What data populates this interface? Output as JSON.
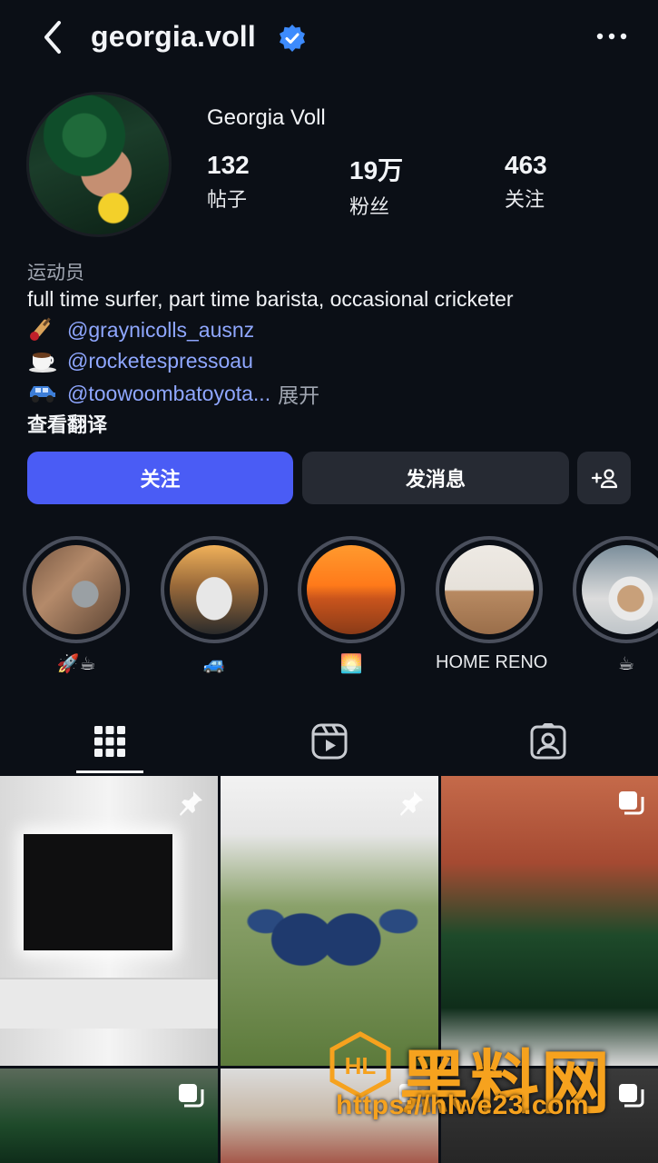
{
  "header": {
    "username": "georgia.voll",
    "verified": true,
    "icons": {
      "back": "back-chevron-icon",
      "verified": "verified-badge-icon",
      "more": "more-dots-icon"
    }
  },
  "profile": {
    "display_name": "Georgia Voll",
    "stats": [
      {
        "value": "132",
        "label": "帖子"
      },
      {
        "value": "19万",
        "label": "粉丝"
      },
      {
        "value": "463",
        "label": "关注"
      }
    ],
    "category": "运动员",
    "bio_text": "full time surfer, part time barista, occasional cricketer",
    "bio_links": [
      {
        "emoji": "cricket-bat-icon",
        "handle": "@graynicolls_ausnz"
      },
      {
        "emoji": "coffee-cup-icon",
        "handle": "@rocketespressoau"
      },
      {
        "emoji": "car-icon",
        "handle": "@toowoombatoyota",
        "truncated": "...",
        "expand": "展开"
      }
    ],
    "translate": "查看翻译"
  },
  "actions": {
    "follow": "关注",
    "message": "发消息",
    "add_user_icon": "add-person-icon"
  },
  "highlights": [
    {
      "label": "🚀☕",
      "icon": "rocket-coffee"
    },
    {
      "label": "🚙",
      "icon": "car"
    },
    {
      "label": "🌅",
      "icon": "sunset"
    },
    {
      "label": "HOME RENO",
      "icon": ""
    },
    {
      "label": "☕",
      "icon": "coffee"
    }
  ],
  "tabs": [
    {
      "name": "grid-tab",
      "icon": "grid-icon",
      "active": true
    },
    {
      "name": "reels-tab",
      "icon": "reels-icon",
      "active": false
    },
    {
      "name": "tagged-tab",
      "icon": "tagged-person-icon",
      "active": false
    }
  ],
  "grid_badges": [
    "pin-icon",
    "pin-icon",
    "multi-post-icon",
    "multi-post-icon",
    "multi-post-icon",
    "multi-post-icon"
  ],
  "watermark": {
    "brand": "黑料网",
    "url": "https://hlwe23.com"
  },
  "colors": {
    "background": "#0b0f16",
    "primary_button": "#4a5cf5",
    "secondary_button": "#262a33",
    "link": "#8fa7ff",
    "verified": "#3d8bfd",
    "watermark": "#f6a21e"
  }
}
